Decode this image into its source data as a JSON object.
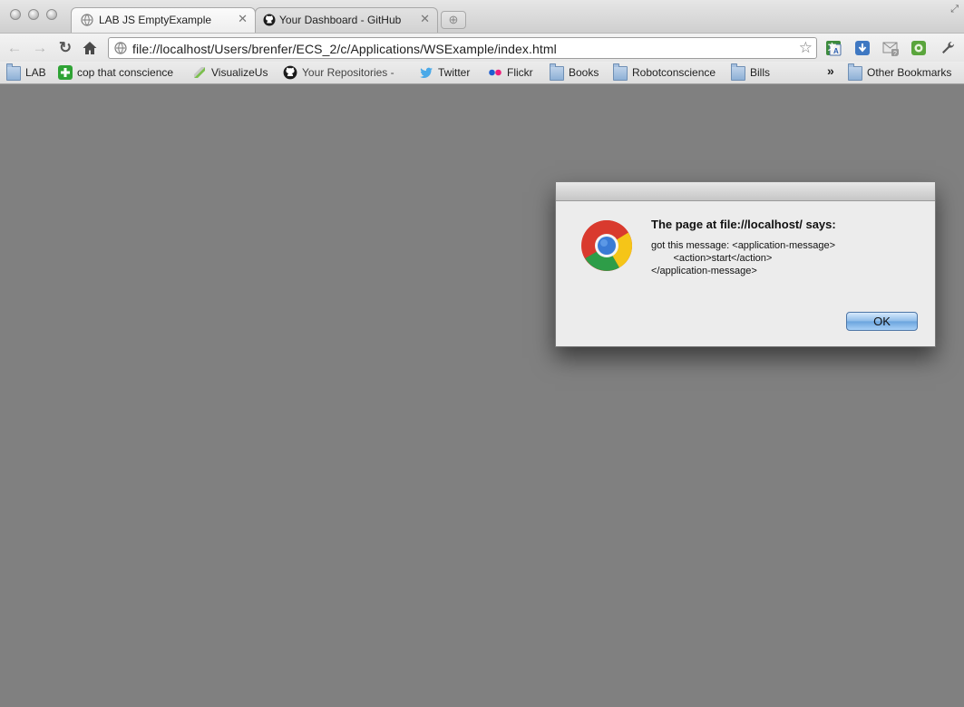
{
  "tabs": [
    {
      "title": "LAB JS EmptyExample",
      "active": true,
      "favicon": "globe-icon"
    },
    {
      "title": "Your Dashboard - GitHub",
      "active": false,
      "favicon": "github-icon"
    }
  ],
  "toolbar": {
    "url": "file://localhost/Users/brenfer/ECS_2/c/Applications/WSExample/index.html"
  },
  "bookmarks": [
    {
      "label": "LAB",
      "icon": "folder-icon"
    },
    {
      "label": "cop that conscience",
      "icon": "plus-icon"
    },
    {
      "label": "VisualizeUs",
      "icon": "visualizeus-icon"
    },
    {
      "label": "Your Repositories - ",
      "icon": "github-icon"
    },
    {
      "label": "Twitter",
      "icon": "twitter-icon"
    },
    {
      "label": "Flickr",
      "icon": "flickr-icon"
    },
    {
      "label": "Books",
      "icon": "folder-icon"
    },
    {
      "label": "Robotconscience",
      "icon": "folder-icon"
    },
    {
      "label": "Bills",
      "icon": "folder-icon"
    }
  ],
  "bookmarks_overflow": "»",
  "other_bookmarks": "Other Bookmarks",
  "dialog": {
    "heading": "The page at file://localhost/ says:",
    "message": "got this message: <application-message>\n        <action>start</action>\n</application-message>",
    "ok_label": "OK"
  },
  "colors": {
    "page_background": "#808080",
    "ok_button": "#8dbbe9"
  }
}
